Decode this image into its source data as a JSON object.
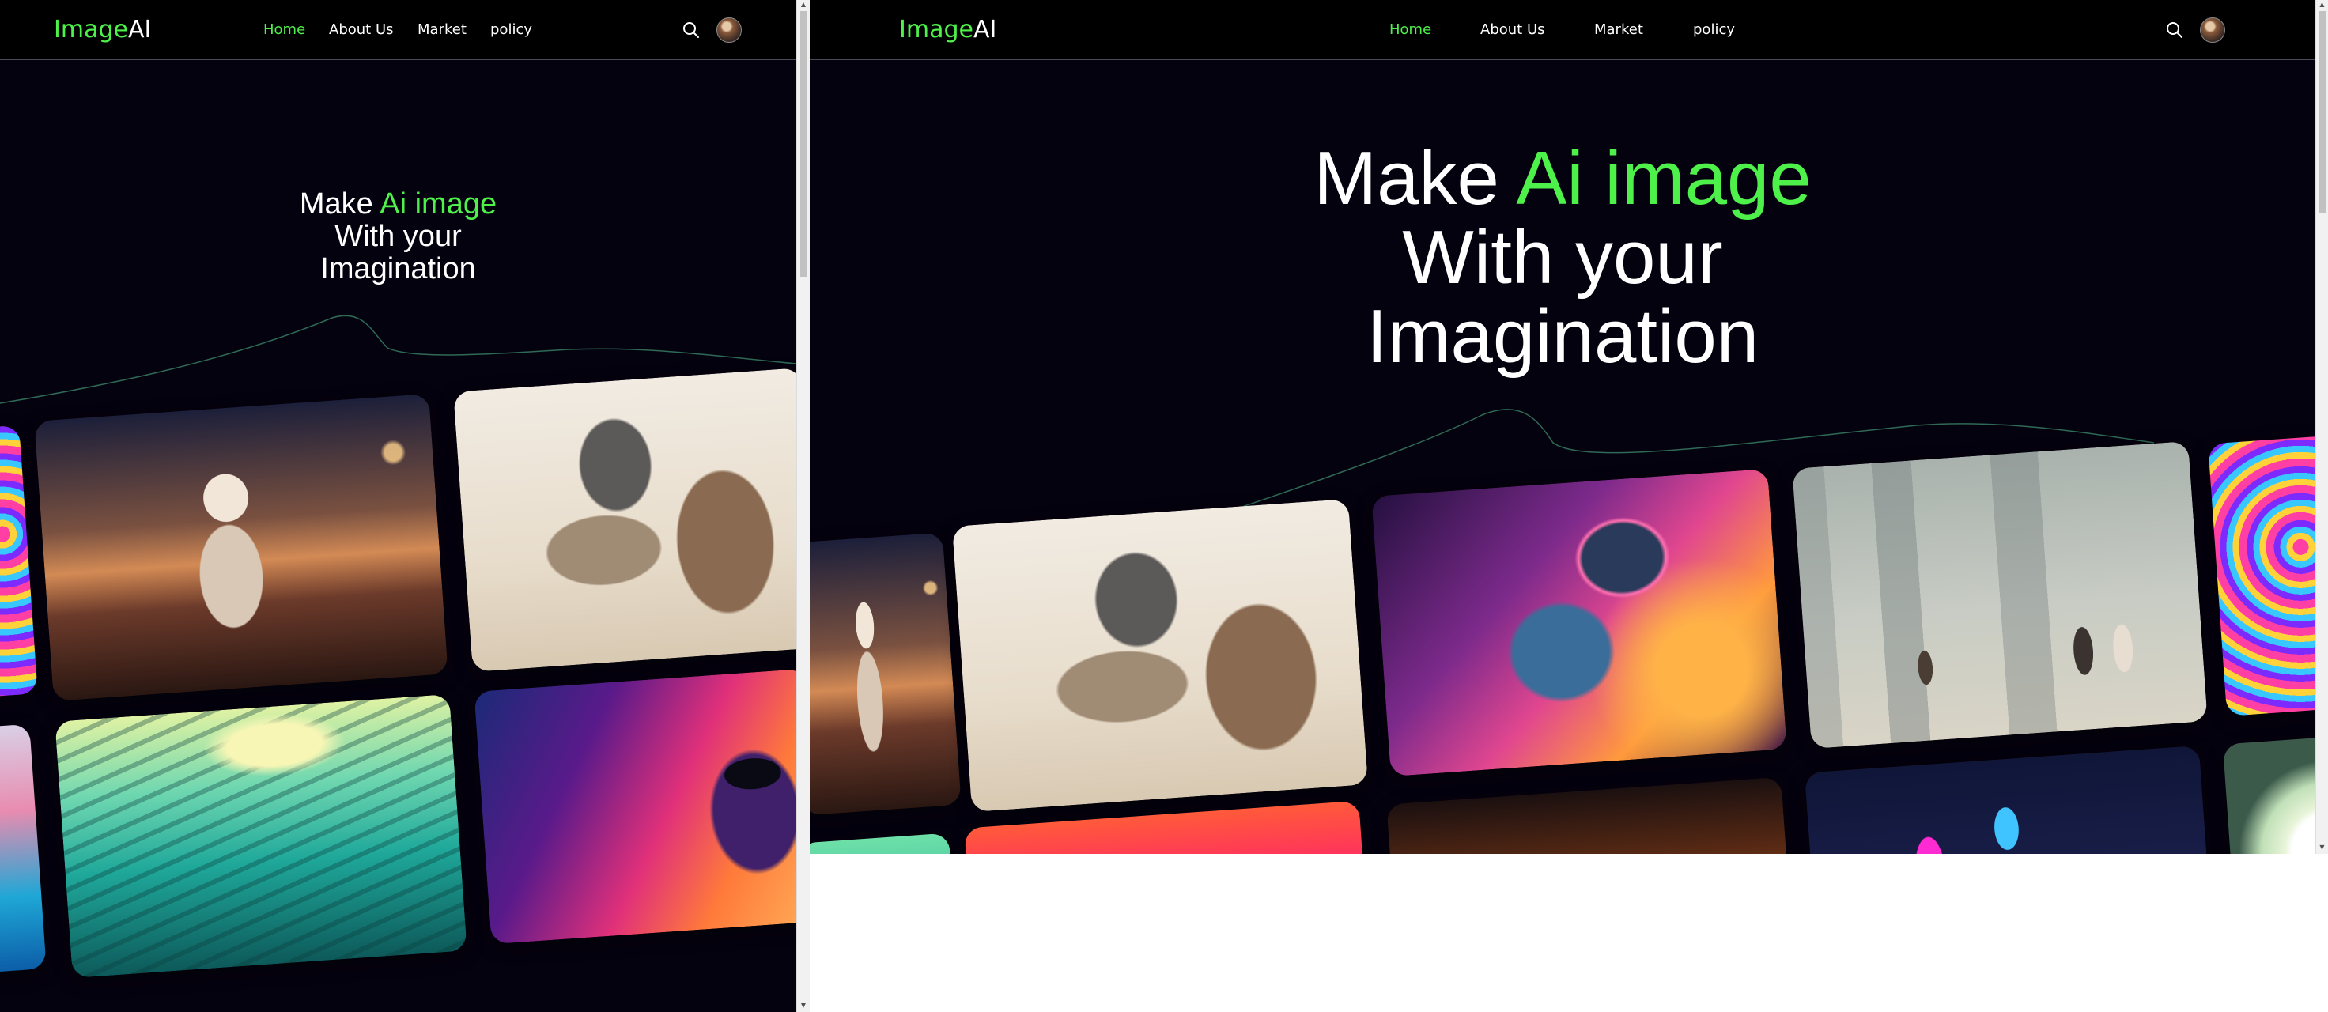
{
  "brand": {
    "part1": "Image",
    "part2": "AI"
  },
  "nav": {
    "home": "Home",
    "about": "About Us",
    "market": "Market",
    "policy": "policy"
  },
  "hero": {
    "line1_prefix": "Make ",
    "line1_accent": "Ai image",
    "line2": "With your",
    "line3": "Imagination"
  },
  "icons": {
    "search": "search-icon",
    "avatar": "user-avatar"
  },
  "colors": {
    "accent": "#4ef04a",
    "background": "#05020f",
    "navbar": "#000000"
  }
}
